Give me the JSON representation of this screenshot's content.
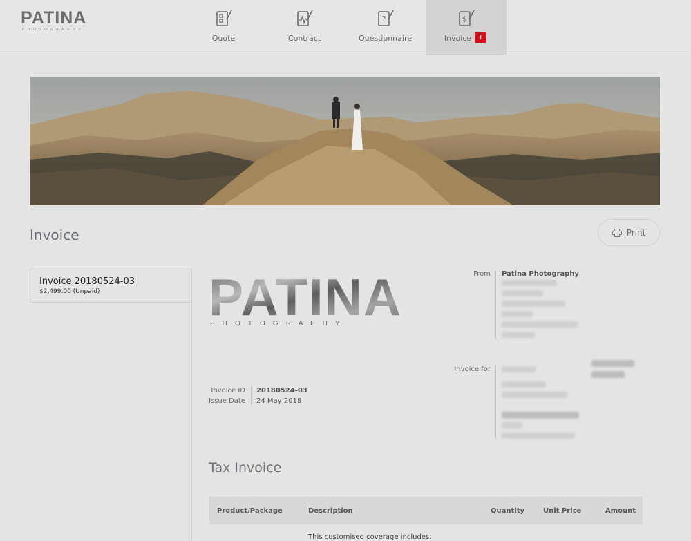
{
  "header": {
    "brand": "PATINA",
    "brand_sub": "PHOTOGRAPHY",
    "nav": [
      {
        "label": "Quote",
        "icon": "quote-list-icon"
      },
      {
        "label": "Contract",
        "icon": "contract-signature-icon"
      },
      {
        "label": "Questionnaire",
        "icon": "questionnaire-icon"
      },
      {
        "label": "Invoice",
        "icon": "invoice-dollar-icon",
        "badge": "1",
        "active": true
      }
    ]
  },
  "page": {
    "title": "Invoice",
    "print_label": "Print"
  },
  "sidebar": {
    "items": [
      {
        "title": "Invoice 20180524-03",
        "subtitle": "$2,499.00 (Unpaid)"
      }
    ]
  },
  "invoice": {
    "logo_word": "PATINA",
    "logo_sub": "P H O T O G R A P H Y",
    "from_label": "From",
    "from_name": "Patina Photography",
    "for_label": "Invoice for",
    "id_label": "Invoice ID",
    "id_value": "20180524-03",
    "date_label": "Issue Date",
    "date_value": "24 May 2018",
    "section_title": "Tax Invoice",
    "table": {
      "columns": [
        "Product/Package",
        "Description",
        "Quantity",
        "Unit Price",
        "Amount"
      ],
      "first_row_description": "This customised coverage includes:"
    }
  },
  "colors": {
    "badge": "#c9141e",
    "active_tab": "#d3d3d3",
    "background": "#e4e4e4"
  }
}
